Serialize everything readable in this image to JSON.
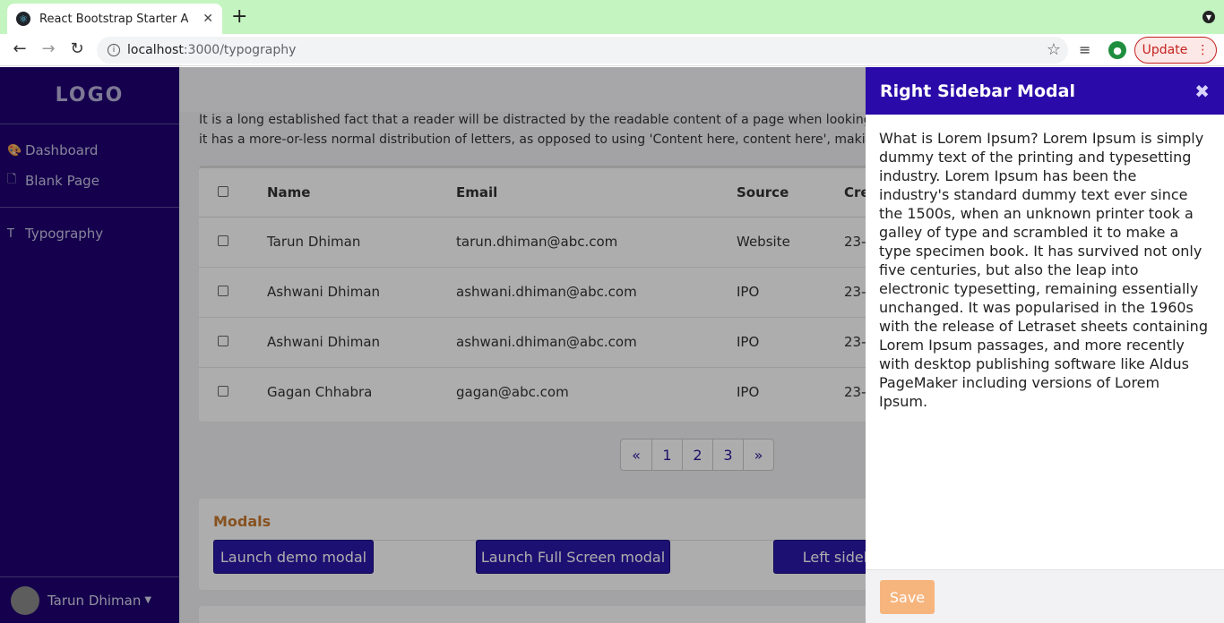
{
  "browser": {
    "tab_title": "React Bootstrap Starter A",
    "url_host": "localhost",
    "url_path": ":3000/typography",
    "update_label": "Update"
  },
  "sidebar": {
    "logo": "LOGO",
    "items": [
      {
        "label": "Dashboard",
        "icon": "palette-icon"
      },
      {
        "label": "Blank Page",
        "icon": "file-icon"
      },
      {
        "label": "Typography",
        "icon": "text-icon"
      }
    ],
    "user_name": "Tarun Dhiman"
  },
  "main": {
    "intro_line1": "It is a long established fact that a reader will be distracted by the readable content of a page when looking",
    "intro_line2": "it has a more-or-less normal distribution of letters, as opposed to using 'Content here, content here', makin",
    "table": {
      "headers": [
        "Name",
        "Email",
        "Source",
        "Cre"
      ],
      "rows": [
        {
          "name": "Tarun Dhiman",
          "email": "tarun.dhiman@abc.com",
          "source": "Website",
          "created": "23-"
        },
        {
          "name": "Ashwani Dhiman",
          "email": "ashwani.dhiman@abc.com",
          "source": "IPO",
          "created": "23-"
        },
        {
          "name": "Ashwani Dhiman",
          "email": "ashwani.dhiman@abc.com",
          "source": "IPO",
          "created": "23-"
        },
        {
          "name": "Gagan Chhabra",
          "email": "gagan@abc.com",
          "source": "IPO",
          "created": "23-"
        }
      ]
    },
    "pagination": [
      "«",
      "1",
      "2",
      "3",
      "»"
    ],
    "modals": {
      "title": "Modals",
      "btn_demo": "Launch demo modal",
      "btn_fullscreen": "Launch Full Screen modal",
      "btn_left": "Left sidebar"
    }
  },
  "right_modal": {
    "title": "Right Sidebar Modal",
    "close": "✖",
    "body": "What is Lorem Ipsum? Lorem Ipsum is simply dummy text of the printing and typesetting industry. Lorem Ipsum has been the industry's standard dummy text ever since the 1500s, when an unknown printer took a galley of type and scrambled it to make a type specimen book. It has survived not only five centuries, but also the leap into electronic typesetting, remaining essentially unchanged. It was popularised in the 1960s with the release of Letraset sheets containing Lorem Ipsum passages, and more recently with desktop publishing software like Aldus PageMaker including versions of Lorem Ipsum.",
    "save_label": "Save"
  }
}
